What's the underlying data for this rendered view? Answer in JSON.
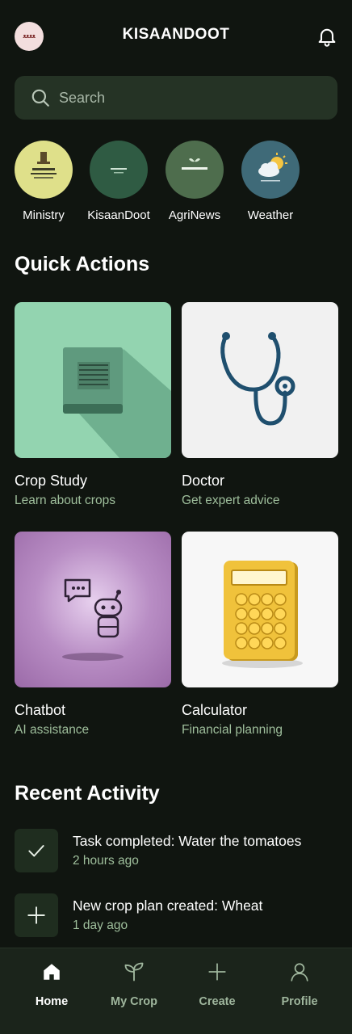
{
  "header": {
    "title": "KISAANDOOT",
    "logo_text": "ᴥᴥᴥᴥ"
  },
  "search": {
    "placeholder": "Search"
  },
  "stories": [
    {
      "label": "Ministry",
      "icon": "ministry-emblem",
      "color": "#dfe08a"
    },
    {
      "label": "KisaanDoot",
      "icon": "kisaandoot-logo",
      "color": "#2f5b43"
    },
    {
      "label": "AgriNews",
      "icon": "agrinews-logo",
      "color": "#4e6d4d"
    },
    {
      "label": "Weather",
      "icon": "weather-sun-cloud",
      "color": "#3f6a78"
    }
  ],
  "quick_actions": {
    "title": "Quick Actions",
    "cards": [
      {
        "title": "Crop Study",
        "subtitle": "Learn about crops",
        "icon": "book-icon",
        "color": "#93d4b0"
      },
      {
        "title": "Doctor",
        "subtitle": "Get expert advice",
        "icon": "stethoscope-icon",
        "color": "#f1f1f1"
      },
      {
        "title": "Chatbot",
        "subtitle": "AI assistance",
        "icon": "robot-icon",
        "color": "#a77ab4"
      },
      {
        "title": "Calculator",
        "subtitle": "Financial planning",
        "icon": "calculator-icon",
        "color": "#f5f5f5"
      }
    ]
  },
  "recent_activity": {
    "title": "Recent Activity",
    "items": [
      {
        "title": "Task completed: Water the tomatoes",
        "time": "2 hours ago",
        "icon": "check-icon"
      },
      {
        "title": "New crop plan created: Wheat",
        "time": "1 day ago",
        "icon": "plus-icon"
      }
    ]
  },
  "nav": [
    {
      "label": "Home",
      "icon": "home-icon",
      "active": true
    },
    {
      "label": "My Crop",
      "icon": "sprout-icon",
      "active": false
    },
    {
      "label": "Create",
      "icon": "plus-icon",
      "active": false
    },
    {
      "label": "Profile",
      "icon": "person-icon",
      "active": false
    }
  ]
}
